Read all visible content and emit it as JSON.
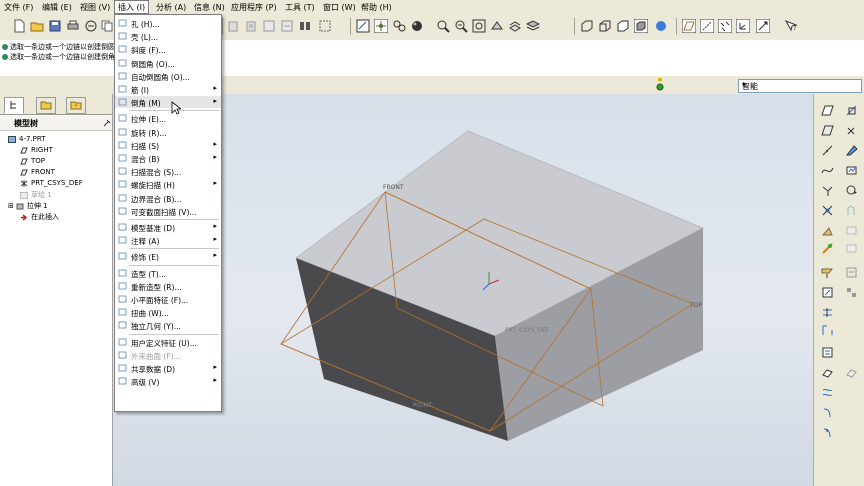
{
  "menubar": {
    "items": [
      "文件 (F)",
      "编辑 (E)",
      "视图 (V)",
      "插入 (I)",
      "分析 (A)",
      "信息 (N)",
      "应用程序 (P)",
      "工具 (T)",
      "窗口 (W)",
      "帮助 (H)"
    ]
  },
  "messages": [
    "选取一条边或一个边链以创建倒圆角。",
    "选取一条边或一个边链以创建倒角。"
  ],
  "filter": {
    "selected": "智能"
  },
  "model_tree": {
    "header": "模型树",
    "items": [
      {
        "label": "4-7.PRT",
        "dim": false
      },
      {
        "label": "RIGHT",
        "dim": false
      },
      {
        "label": "TOP",
        "dim": false
      },
      {
        "label": "FRONT",
        "dim": false
      },
      {
        "label": "PRT_CSYS_DEF",
        "dim": false
      },
      {
        "label": "草绘 1",
        "dim": true
      },
      {
        "label": "拉伸 1",
        "dim": false
      },
      {
        "label": "在此插入",
        "dim": false
      }
    ]
  },
  "insert_menu": [
    {
      "label": "孔 (H)...",
      "sub": false,
      "dim": false
    },
    {
      "label": "壳 (L)...",
      "sub": false,
      "dim": false
    },
    {
      "label": "斜度 (F)...",
      "sub": false,
      "dim": false
    },
    {
      "label": "倒圆角 (O)...",
      "sub": false,
      "dim": false
    },
    {
      "label": "自动倒圆角 (O)...",
      "sub": false,
      "dim": false
    },
    {
      "label": "筋 (I)",
      "sub": true,
      "dim": false
    },
    {
      "label": "倒角 (M)",
      "sub": true,
      "dim": false,
      "hl": true
    },
    {
      "sep": true
    },
    {
      "label": "拉伸 (E)...",
      "sub": false,
      "dim": false
    },
    {
      "label": "旋转 (R)...",
      "sub": false,
      "dim": false
    },
    {
      "label": "扫描 (S)",
      "sub": true,
      "dim": false
    },
    {
      "label": "混合 (B)",
      "sub": true,
      "dim": false
    },
    {
      "label": "扫描混合 (S)...",
      "sub": false,
      "dim": false
    },
    {
      "label": "螺旋扫描 (H)",
      "sub": true,
      "dim": false
    },
    {
      "label": "边界混合 (B)...",
      "sub": false,
      "dim": false
    },
    {
      "label": "可变截面扫描 (V)...",
      "sub": false,
      "dim": false
    },
    {
      "sep": true
    },
    {
      "label": "模型基准 (D)",
      "sub": true,
      "dim": false
    },
    {
      "label": "注释 (A)",
      "sub": true,
      "dim": false
    },
    {
      "sep": true
    },
    {
      "label": "修饰 (E)",
      "sub": true,
      "dim": false
    },
    {
      "sep": true
    },
    {
      "label": "造型 (T)...",
      "sub": false,
      "dim": false
    },
    {
      "label": "重新造型 (R)...",
      "sub": false,
      "dim": false
    },
    {
      "label": "小平面特征 (F)...",
      "sub": false,
      "dim": false
    },
    {
      "label": "扭曲 (W)...",
      "sub": false,
      "dim": false
    },
    {
      "label": "独立几何 (Y)...",
      "sub": false,
      "dim": false
    },
    {
      "sep": true
    },
    {
      "label": "用户定义特征 (U)...",
      "sub": false,
      "dim": false
    },
    {
      "label": "外来曲面 (F)...",
      "sub": false,
      "dim": true
    },
    {
      "label": "共享数据 (D)",
      "sub": true,
      "dim": false
    },
    {
      "label": "高级 (V)",
      "sub": true,
      "dim": false
    }
  ],
  "viewport_labels": {
    "front": "FRONT",
    "top": "TOP",
    "csys": "PRT_CSYS_DEF",
    "right": "RIGHT"
  },
  "colors": {
    "accent": "#316ac5",
    "face_top": "#c9cbd0",
    "face_left": "#4a4a4c",
    "face_right": "#9c9ea3",
    "datum": "#b5712c"
  }
}
